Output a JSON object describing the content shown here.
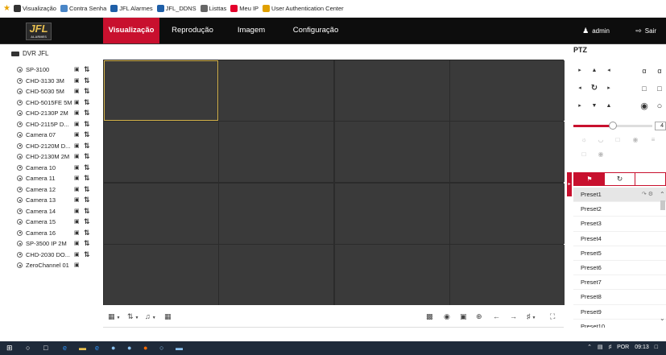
{
  "bookmarks": [
    {
      "label": "Visualização",
      "icon": "globe-icon",
      "color": "#333333"
    },
    {
      "label": "Contra Senha",
      "icon": "page-icon",
      "color": "#4a86c7"
    },
    {
      "label": "JFL Alarmes",
      "icon": "jfl-icon",
      "color": "#1f5fa8"
    },
    {
      "label": "JFL_DDNS",
      "icon": "jfl-icon",
      "color": "#1f5fa8"
    },
    {
      "label": "Listtas",
      "icon": "list-icon",
      "color": "#666666"
    },
    {
      "label": "Meu IP",
      "icon": "ip-icon",
      "color": "#e4002b"
    },
    {
      "label": "User Authentication Center",
      "icon": "users-icon",
      "color": "#e0a000"
    }
  ],
  "header": {
    "logo_text": "JFL",
    "logo_subtext": "ALARMES",
    "tabs": [
      {
        "label": "Visualização",
        "active": true
      },
      {
        "label": "Reprodução",
        "active": false
      },
      {
        "label": "Imagem",
        "active": false
      },
      {
        "label": "Configuração",
        "active": false
      }
    ],
    "user": "admin",
    "logout": "Sair"
  },
  "device": {
    "title": "DVR JFL",
    "cameras": [
      {
        "name": "SP-3100",
        "ptz": true
      },
      {
        "name": "CHD-3130 3M",
        "ptz": true
      },
      {
        "name": "CHD-5030 5M",
        "ptz": true
      },
      {
        "name": "CHD-5015FE 5M",
        "ptz": true
      },
      {
        "name": "CHD-2130P 2M",
        "ptz": true
      },
      {
        "name": "CHD-2115P D...",
        "ptz": true
      },
      {
        "name": "Camera 07",
        "ptz": true
      },
      {
        "name": "CHD-2120M D...",
        "ptz": true
      },
      {
        "name": "CHD-2130M 2M",
        "ptz": true
      },
      {
        "name": "Camera 10",
        "ptz": true
      },
      {
        "name": "Camera 11",
        "ptz": true
      },
      {
        "name": "Camera 12",
        "ptz": true
      },
      {
        "name": "Camera 13",
        "ptz": true
      },
      {
        "name": "Camera 14",
        "ptz": true
      },
      {
        "name": "Camera 15",
        "ptz": true
      },
      {
        "name": "Camera 16",
        "ptz": true
      },
      {
        "name": "SP-3500 IP 2M",
        "ptz": true
      },
      {
        "name": "CHD-2030 DO...",
        "ptz": true
      },
      {
        "name": "ZeroChannel 01",
        "ptz": false
      }
    ]
  },
  "ptz": {
    "title": "PTZ",
    "speed": "4",
    "speed_fraction": 0.5,
    "presets": [
      "Preset1",
      "Preset2",
      "Preset3",
      "Preset4",
      "Preset5",
      "Preset6",
      "Preset7",
      "Preset8",
      "Preset9",
      "Preset10"
    ],
    "active_preset": 0
  },
  "taskbar": {
    "language": "POR",
    "time": "09:13"
  },
  "colors": {
    "accent": "#c8102e",
    "selected_cell": "#d4b24a",
    "grid_bg": "#2b2b2b"
  }
}
